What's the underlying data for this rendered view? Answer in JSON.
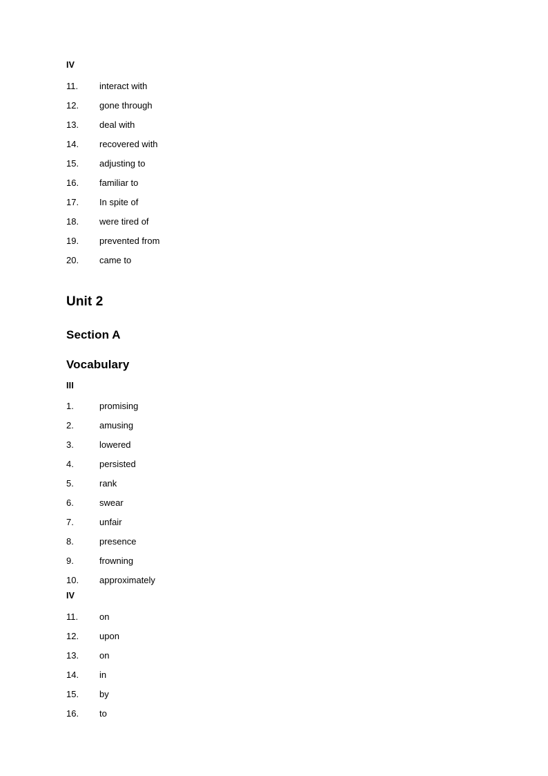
{
  "document": {
    "page_background": "#ffffff",
    "text_color": "#000000"
  },
  "blocks": {
    "group_iv_top": {
      "marker": "IV",
      "items": [
        {
          "number": "11.",
          "answer": "interact with"
        },
        {
          "number": "12.",
          "answer": "gone through"
        },
        {
          "number": "13.",
          "answer": "deal with"
        },
        {
          "number": "14.",
          "answer": "recovered with"
        },
        {
          "number": "15.",
          "answer": "adjusting to"
        },
        {
          "number": "16.",
          "answer": "familiar to"
        },
        {
          "number": "17.",
          "answer": "In spite of"
        },
        {
          "number": "18.",
          "answer": "were tired of"
        },
        {
          "number": "19.",
          "answer": "prevented from"
        },
        {
          "number": "20.",
          "answer": "came to"
        }
      ]
    },
    "unit_heading": "Unit 2",
    "section_heading": "Section A",
    "vocabulary_heading": "Vocabulary",
    "group_iii": {
      "marker": "III",
      "items": [
        {
          "number": "1.",
          "answer": "promising"
        },
        {
          "number": "2.",
          "answer": "amusing"
        },
        {
          "number": "3.",
          "answer": "lowered"
        },
        {
          "number": "4.",
          "answer": "persisted"
        },
        {
          "number": "5.",
          "answer": "rank"
        },
        {
          "number": "6.",
          "answer": "swear"
        },
        {
          "number": "7.",
          "answer": "unfair"
        },
        {
          "number": "8.",
          "answer": "presence"
        },
        {
          "number": "9.",
          "answer": "frowning"
        },
        {
          "number": "10.",
          "answer": "approximately"
        }
      ]
    },
    "group_iv_bottom": {
      "marker": "IV",
      "items": [
        {
          "number": "11.",
          "answer": "on"
        },
        {
          "number": "12.",
          "answer": "upon"
        },
        {
          "number": "13.",
          "answer": "on"
        },
        {
          "number": "14.",
          "answer": "in"
        },
        {
          "number": "15.",
          "answer": "by"
        },
        {
          "number": "16.",
          "answer": "to"
        }
      ]
    }
  }
}
